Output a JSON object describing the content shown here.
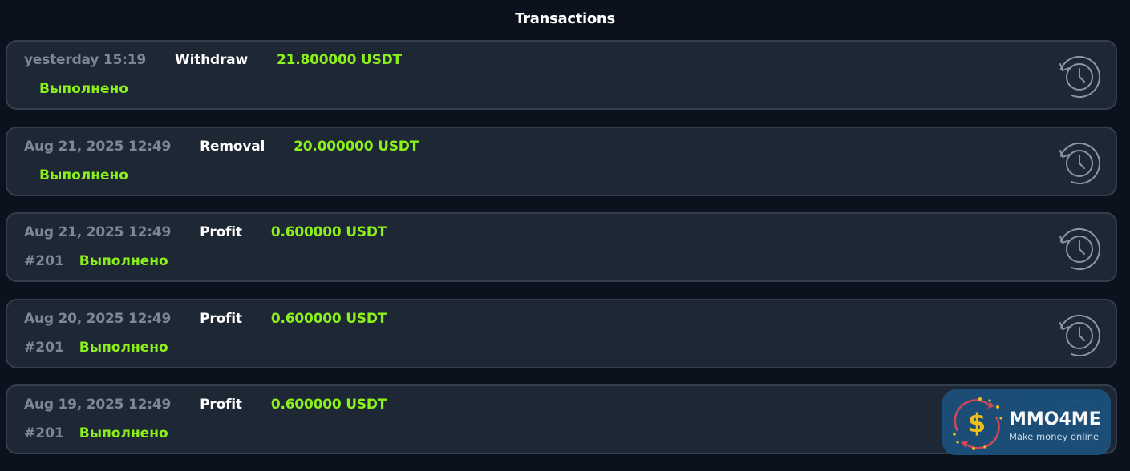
{
  "page": {
    "title": "Transactions"
  },
  "transactions": [
    {
      "date": "yesterday 15:19",
      "type": "Withdraw",
      "amount": "21.800000 USDT",
      "id": "",
      "status": "Выполнено"
    },
    {
      "date": "Aug 21, 2025 12:49",
      "type": "Removal",
      "amount": "20.000000 USDT",
      "id": "",
      "status": "Выполнено"
    },
    {
      "date": "Aug 21, 2025 12:49",
      "type": "Profit",
      "amount": "0.600000 USDT",
      "id": "#201",
      "status": "Выполнено"
    },
    {
      "date": "Aug 20, 2025 12:49",
      "type": "Profit",
      "amount": "0.600000 USDT",
      "id": "#201",
      "status": "Выполнено"
    },
    {
      "date": "Aug 19, 2025 12:49",
      "type": "Profit",
      "amount": "0.600000 USDT",
      "id": "#201",
      "status": "Выполнено"
    }
  ],
  "icons": {
    "history": "history-clock-icon",
    "watermark_logo": "dollar-coin-icon"
  },
  "watermark": {
    "title": "MMO4ME",
    "subtitle": "Make money online"
  },
  "colors": {
    "background": "#0b121d",
    "card": "#1e2734",
    "card_border": "#353e4c",
    "amount": "#8cf01a",
    "status": "#8cf01a",
    "muted": "#7d8797",
    "watermark_bg": "#1b4f7a"
  }
}
